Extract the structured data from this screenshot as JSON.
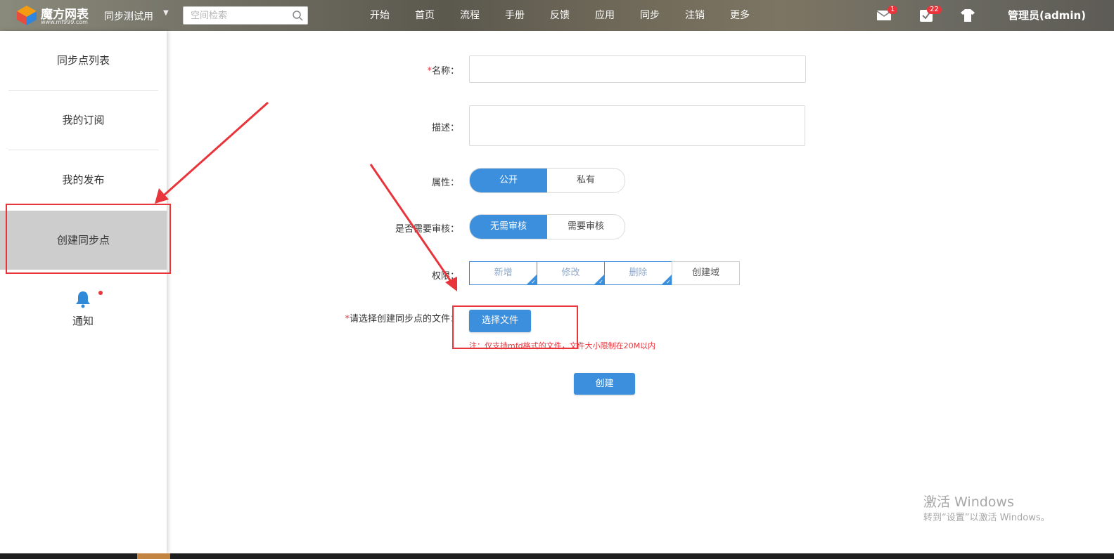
{
  "header": {
    "logo_title": "魔方网表",
    "logo_url": "www.mf999.com",
    "space_selector": "同步测试用",
    "search_placeholder": "空间检索",
    "nav": [
      "开始",
      "首页",
      "流程",
      "手册",
      "反馈",
      "应用",
      "同步",
      "注销",
      "更多"
    ],
    "mail_badge": "1",
    "task_badge": "22",
    "user": "管理员(admin)"
  },
  "sidebar": {
    "items": [
      "同步点列表",
      "我的订阅",
      "我的发布",
      "创建同步点"
    ],
    "active_index": 3,
    "notify_label": "通知"
  },
  "form": {
    "name_label": "名称：",
    "desc_label": "描述：",
    "attr_label": "属性：",
    "attr_options": [
      "公开",
      "私有"
    ],
    "attr_selected": "公开",
    "audit_label": "是否需要审核：",
    "audit_options": [
      "无需审核",
      "需要审核"
    ],
    "audit_selected": "无需审核",
    "perm_label": "权限：",
    "perm_options": [
      "新增",
      "修改",
      "删除",
      "创建域"
    ],
    "perm_checked": [
      "新增",
      "修改",
      "删除"
    ],
    "file_label": "请选择创建同步点的文件：",
    "file_button": "选择文件",
    "file_note": "注：仅支持mfd格式的文件，文件大小限制在20M以内",
    "submit": "创建",
    "required_mark": "*"
  },
  "os_watermark": {
    "line1": "激活 Windows",
    "line2": "转到“设置”以激活 Windows。"
  },
  "colors": {
    "accent": "#3b8fdc",
    "annotation_red": "#e8353b",
    "sidebar_active": "#cdcdcd"
  }
}
